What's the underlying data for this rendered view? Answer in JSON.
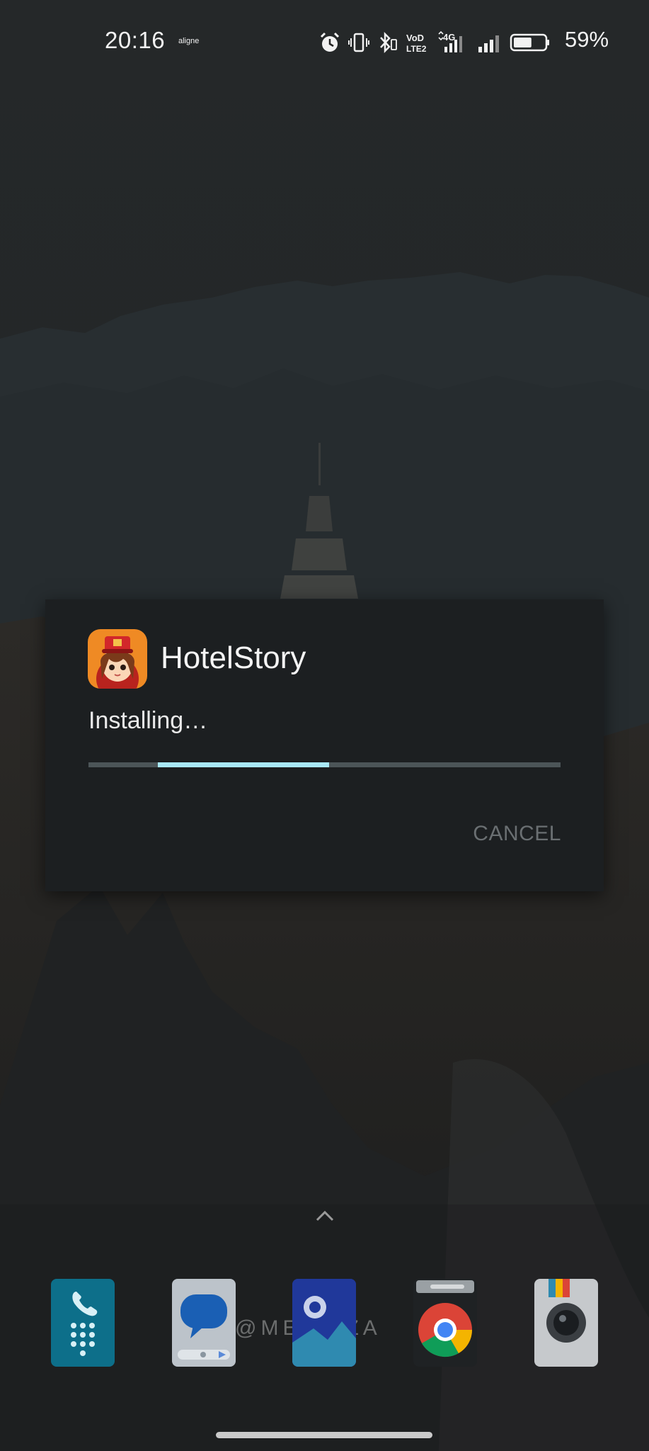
{
  "status_bar": {
    "time": "20:16",
    "carrier_label": "aligne",
    "icons": [
      "alarm-icon",
      "vibrate-icon",
      "bluetooth-icon",
      "volte-icon",
      "mobile-data-4g-icon",
      "signal-icon",
      "battery-icon"
    ],
    "volte_text": "VoD",
    "volte_sub": "LTE2",
    "network_type": "4G",
    "battery_percent": "59%",
    "battery_level": 0.59
  },
  "dialog": {
    "app_name": "HotelStory",
    "status_text": "Installing…",
    "progress": {
      "indeterminate": true,
      "fill_start": 0.147,
      "fill_end": 0.51
    },
    "cancel_label": "CANCEL",
    "colors": {
      "background": "#1c1f21",
      "progress_track": "#4c5558",
      "progress_fill": "#a9e8f8",
      "cancel_text": "#6a6f72"
    }
  },
  "home": {
    "drawer_handle_icon": "chevron-up-icon",
    "watermark": "@ME    LAZA",
    "dock": [
      {
        "name": "phone",
        "icon": "phone-dialer-icon"
      },
      {
        "name": "messages",
        "icon": "messages-icon"
      },
      {
        "name": "gallery",
        "icon": "gallery-icon"
      },
      {
        "name": "chrome",
        "icon": "chrome-icon"
      },
      {
        "name": "camera",
        "icon": "camera-icon"
      }
    ]
  }
}
